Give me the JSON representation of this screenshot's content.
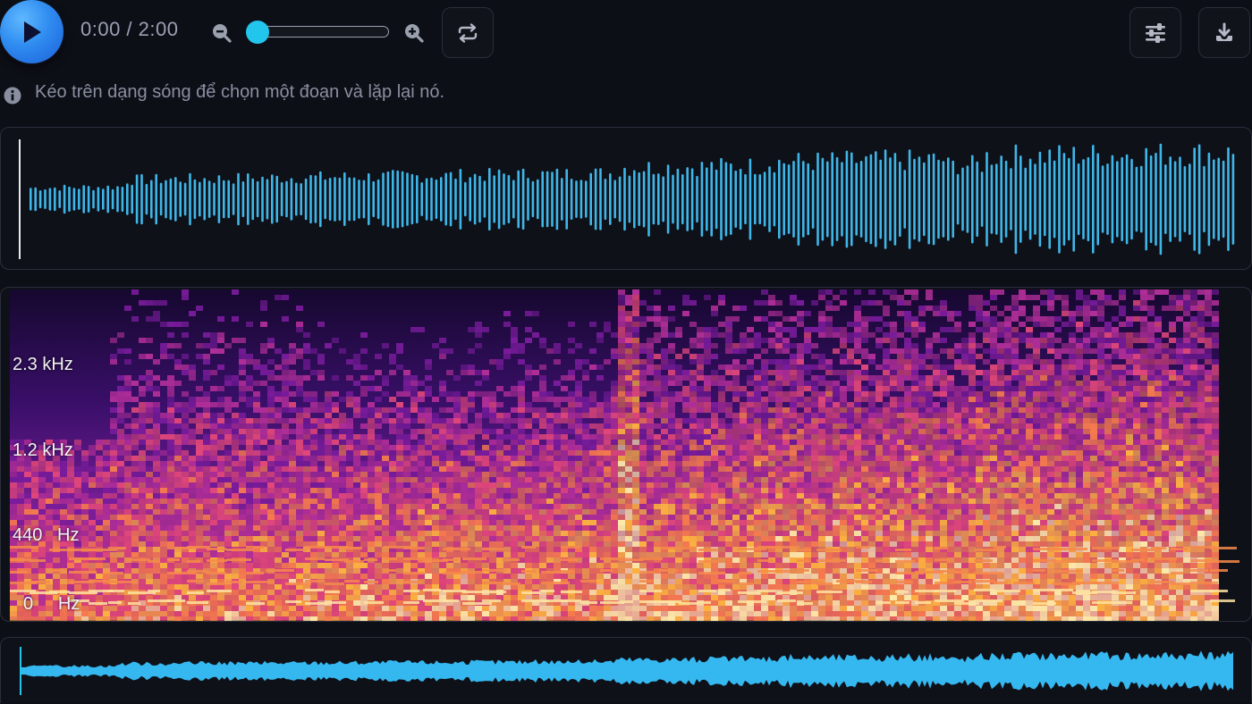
{
  "player": {
    "time_display": "0:00 / 2:00",
    "zoom_level": 0.0
  },
  "hint": {
    "text": "Kéo trên dạng sóng để chọn một đoạn và lặp lại nó."
  },
  "spectrogram": {
    "freq_labels": [
      "2.3  kHz",
      "1.2  kHz",
      "440   Hz",
      "0     Hz"
    ]
  },
  "colors": {
    "accent": "#22c6ec",
    "waveform": "#3fb6e8",
    "play_button": "#2f8cf0",
    "background": "#0d0f17"
  },
  "icons": {
    "play": "play-icon",
    "zoom_out": "zoom-out-icon",
    "zoom_in": "zoom-in-icon",
    "loop": "loop-icon",
    "settings": "sliders-icon",
    "download": "download-icon",
    "info": "info-icon"
  }
}
